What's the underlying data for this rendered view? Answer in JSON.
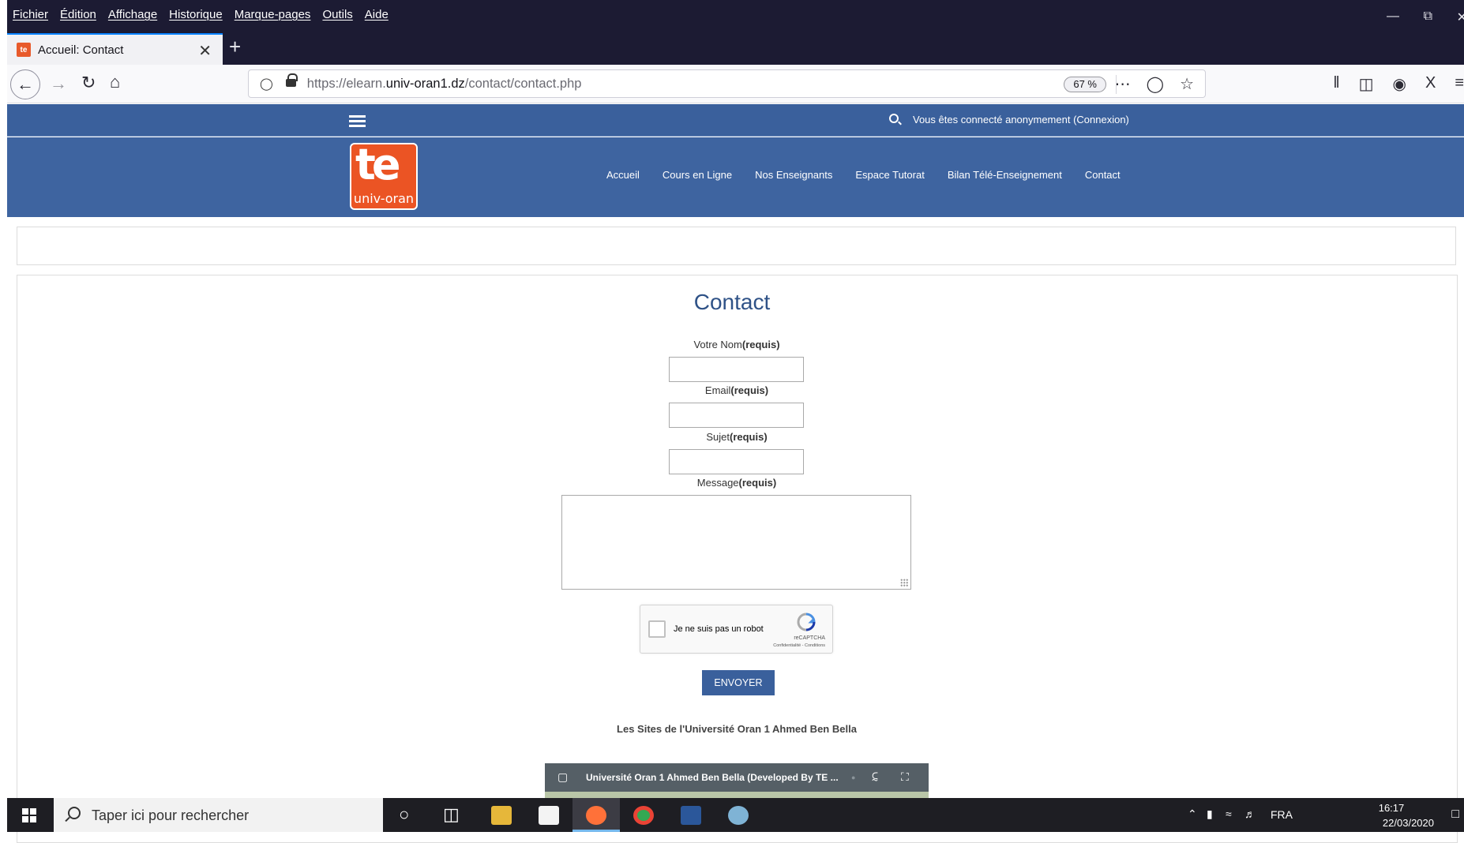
{
  "browser": {
    "menu": [
      "Fichier",
      "Édition",
      "Affichage",
      "Historique",
      "Marque-pages",
      "Outils",
      "Aide"
    ],
    "tab_title": "Accueil: Contact",
    "tab_favicon": "te",
    "url_prefix": "https://elearn.",
    "url_domain": "univ-oran1.dz",
    "url_path": "/contact/contact.php",
    "zoom": "67 %"
  },
  "site": {
    "login_status": "Vous êtes connecté anonymement (Connexion)",
    "logo_text": "te",
    "logo_sub": "univ-oran",
    "nav": [
      "Accueil",
      "Cours en Ligne",
      "Nos Enseignants",
      "Espace Tutorat",
      "Bilan Télé-Enseignement",
      "Contact"
    ]
  },
  "form": {
    "title": "Contact",
    "required_tag": "(requis)",
    "name_label": "Votre Nom",
    "email_label": "Email",
    "subject_label": "Sujet",
    "message_label": "Message",
    "name_value": "",
    "email_value": "",
    "subject_value": "",
    "message_value": "",
    "captcha_label": "Je ne suis pas un robot",
    "captcha_brand": "reCAPTCHA",
    "captcha_terms": "Confidentialité - Conditions",
    "submit_label": "ENVOYER"
  },
  "footer": {
    "sites_text": "Les Sites de l'Université Oran 1 Ahmed Ben Bella",
    "video_title": "Université Oran 1 Ahmed Ben Bella (Developed By TE ..."
  },
  "taskbar": {
    "search_placeholder": "Taper ici pour rechercher",
    "language": "FRA",
    "time": "16:17",
    "date": "22/03/2020"
  },
  "colors": {
    "site_blue": "#3e64a0",
    "logo_orange": "#eb5424",
    "title_blue": "#2f5287"
  }
}
